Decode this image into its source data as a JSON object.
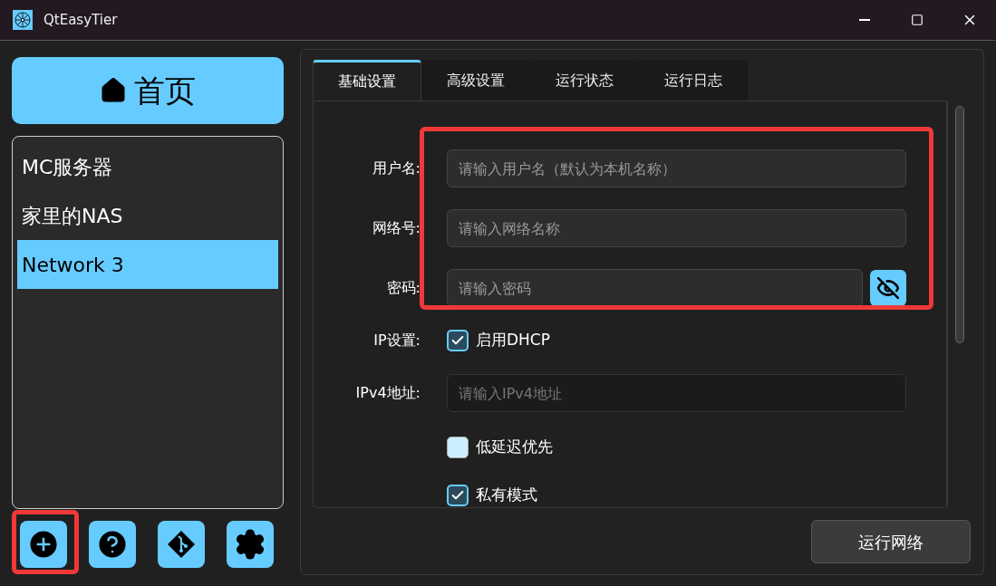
{
  "window": {
    "title": "QtEasyTier"
  },
  "home_button": {
    "label": "首页"
  },
  "networks": [
    {
      "label": "MC服务器",
      "selected": false
    },
    {
      "label": "家里的NAS",
      "selected": false
    },
    {
      "label": "Network 3",
      "selected": true
    }
  ],
  "tabs": [
    {
      "label": "基础设置",
      "selected": true
    },
    {
      "label": "高级设置",
      "selected": false
    },
    {
      "label": "运行状态",
      "selected": false
    },
    {
      "label": "运行日志",
      "selected": false
    }
  ],
  "form": [
    {
      "kind": "field",
      "label": "用户名:",
      "placeholder": "请输入用户名（默认为本机名称）",
      "disabled": false
    },
    {
      "kind": "field",
      "label": "网络号:",
      "placeholder": "请输入网络名称",
      "disabled": false
    },
    {
      "kind": "password",
      "label": "密码:",
      "placeholder": "请输入密码",
      "disabled": false
    },
    {
      "kind": "checkbox",
      "label": "IP设置:",
      "text": "启用DHCP",
      "checked": true
    },
    {
      "kind": "field",
      "label": "IPv4地址:",
      "placeholder": "请输入IPv4地址",
      "disabled": true
    },
    {
      "kind": "checkbox",
      "text": "低延迟优先",
      "checked": false
    },
    {
      "kind": "checkbox",
      "text": "私有模式",
      "checked": true
    }
  ],
  "run_button": {
    "label": "运行网络"
  }
}
